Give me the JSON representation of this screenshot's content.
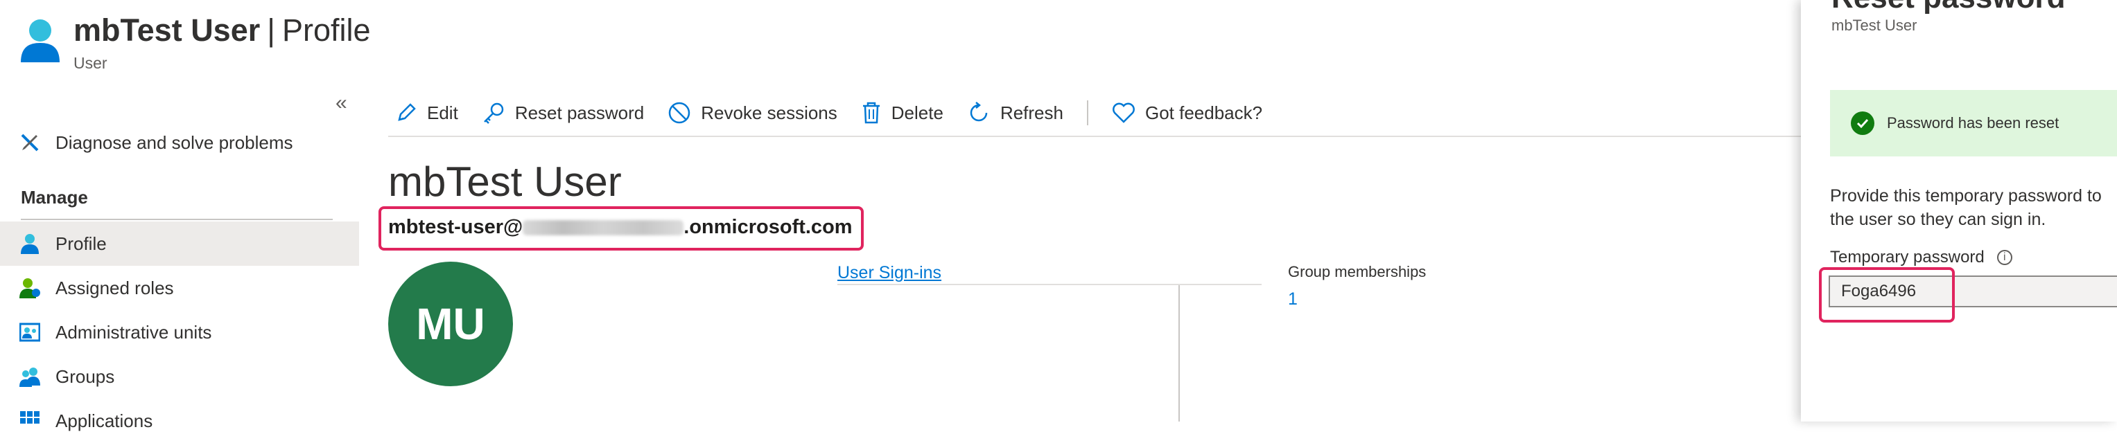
{
  "header": {
    "title_name": "mbTest User",
    "title_separator": "|",
    "title_page": "Profile",
    "subtitle": "User"
  },
  "sidebar": {
    "collapse_glyph": "«",
    "diagnose_label": "Diagnose and solve problems",
    "manage_heading": "Manage",
    "items": [
      {
        "label": "Profile",
        "active": true
      },
      {
        "label": "Assigned roles"
      },
      {
        "label": "Administrative units"
      },
      {
        "label": "Groups"
      },
      {
        "label": "Applications"
      }
    ]
  },
  "toolbar": {
    "edit": "Edit",
    "reset_password": "Reset password",
    "revoke_sessions": "Revoke sessions",
    "delete": "Delete",
    "refresh": "Refresh",
    "feedback": "Got feedback?"
  },
  "main": {
    "user_name": "mbTest User",
    "upn_prefix": "mbtest-user@",
    "upn_suffix": ".onmicrosoft.com",
    "avatar_initials": "MU",
    "signins_link": "User Sign-ins",
    "group_memberships_label": "Group memberships",
    "group_memberships_value": "1"
  },
  "panel": {
    "title": "Reset password",
    "subtitle": "mbTest User",
    "success_message": "Password has been reset",
    "description": "Provide this temporary password to the user so they can sign in.",
    "temp_password_label": "Temporary password",
    "temp_password_value": "Foga6496"
  },
  "colors": {
    "accent": "#0078d4",
    "avatar_bg": "#237b4b",
    "highlight": "#e0245e",
    "success_bg": "#dff6dd",
    "success_icon": "#107c10"
  }
}
